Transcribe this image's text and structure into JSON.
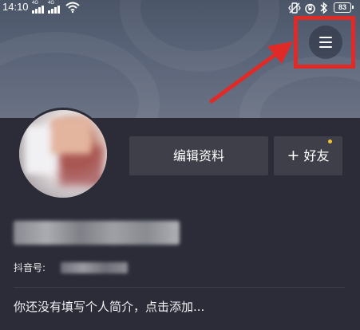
{
  "status_bar": {
    "time": "14:10",
    "signal_1_label": "4G",
    "signal_2_label": "4G",
    "battery": "83",
    "icons": [
      "signal-icon",
      "signal-icon",
      "wifi-icon",
      "vibrate-icon",
      "alarm-icon",
      "bluetooth-icon",
      "battery-icon"
    ]
  },
  "header": {
    "menu_icon": "hamburger-menu-icon",
    "annotation_color": "#e02a27"
  },
  "profile": {
    "edit_profile_label": "编辑资料",
    "add_friend_plus": "+",
    "add_friend_label": "好友",
    "douyin_id_label": "抖音号:",
    "bio_placeholder": "你还没有填写个人简介，点击添加..."
  },
  "colors": {
    "background": "#2b2c37",
    "button": "#3e3f49",
    "notify_dot": "#f2c232"
  }
}
